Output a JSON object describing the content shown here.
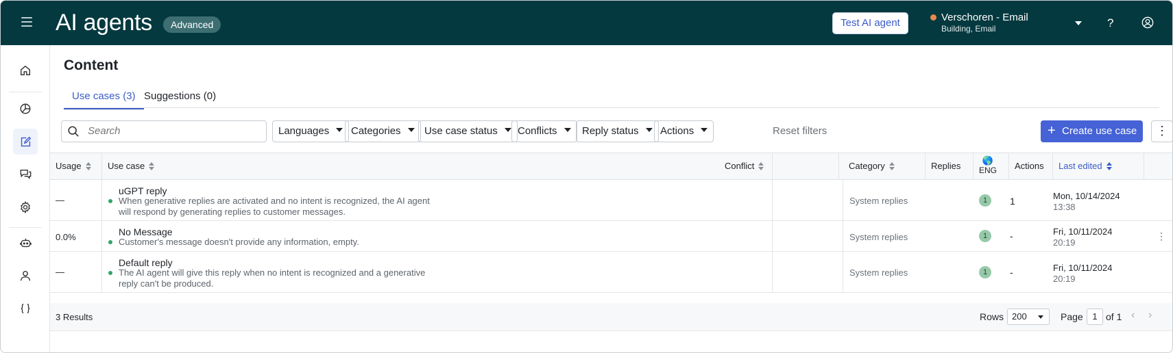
{
  "header": {
    "title": "AI agents",
    "badge": "Advanced",
    "test_button": "Test AI agent",
    "workspace_name": "Verschoren - Email",
    "workspace_sub": "Building, Email",
    "help": "?",
    "status_color": "#e8894a"
  },
  "sidebar": {
    "items": [
      {
        "icon": "home-icon"
      },
      {
        "icon": "pie-chart-icon"
      },
      {
        "icon": "edit-icon",
        "active": true
      },
      {
        "icon": "chat-bubbles-icon"
      },
      {
        "icon": "gear-icon"
      },
      {
        "icon": "bot-icon"
      },
      {
        "icon": "user-icon"
      },
      {
        "icon": "code-braces-icon"
      }
    ]
  },
  "page": {
    "title": "Content",
    "tabs": [
      {
        "label": "Use cases (3)",
        "active": true
      },
      {
        "label": "Suggestions (0)",
        "active": false
      }
    ]
  },
  "filters": {
    "search_placeholder": "Search",
    "buttons": [
      "Languages",
      "Categories",
      "Use case status",
      "Conflicts",
      "Reply status",
      "Actions"
    ],
    "reset": "Reset filters",
    "create": "Create use case"
  },
  "table": {
    "headers": {
      "usage": "Usage",
      "use_case": "Use case",
      "conflict": "Conflict",
      "category": "Category",
      "replies": "Replies",
      "eng": "ENG",
      "actions": "Actions",
      "last_edited": "Last edited"
    },
    "rows": [
      {
        "usage": "—",
        "title": "uGPT reply",
        "desc": "When generative replies are activated and no intent is recognized, the AI agent will respond by generating replies to customer messages.",
        "category": "System replies",
        "eng": "1",
        "actions": "1",
        "date": "Mon, 10/14/2024",
        "time": "13:38"
      },
      {
        "usage": "0.0%",
        "title": "No Message",
        "desc": "Customer's message doesn't provide any information, empty.",
        "category": "System replies",
        "eng": "1",
        "actions": "-",
        "date": "Fri, 10/11/2024",
        "time": "20:19"
      },
      {
        "usage": "—",
        "title": "Default reply",
        "desc": "The AI agent will give this reply when no intent is recognized and a generative reply can't be produced.",
        "category": "System replies",
        "eng": "1",
        "actions": "-",
        "date": "Fri, 10/11/2024",
        "time": "20:19"
      }
    ]
  },
  "footer": {
    "results": "3 Results",
    "rows_label": "Rows",
    "rows_value": "200",
    "page_label": "Page",
    "page_value": "1",
    "of_label": "of 1"
  }
}
